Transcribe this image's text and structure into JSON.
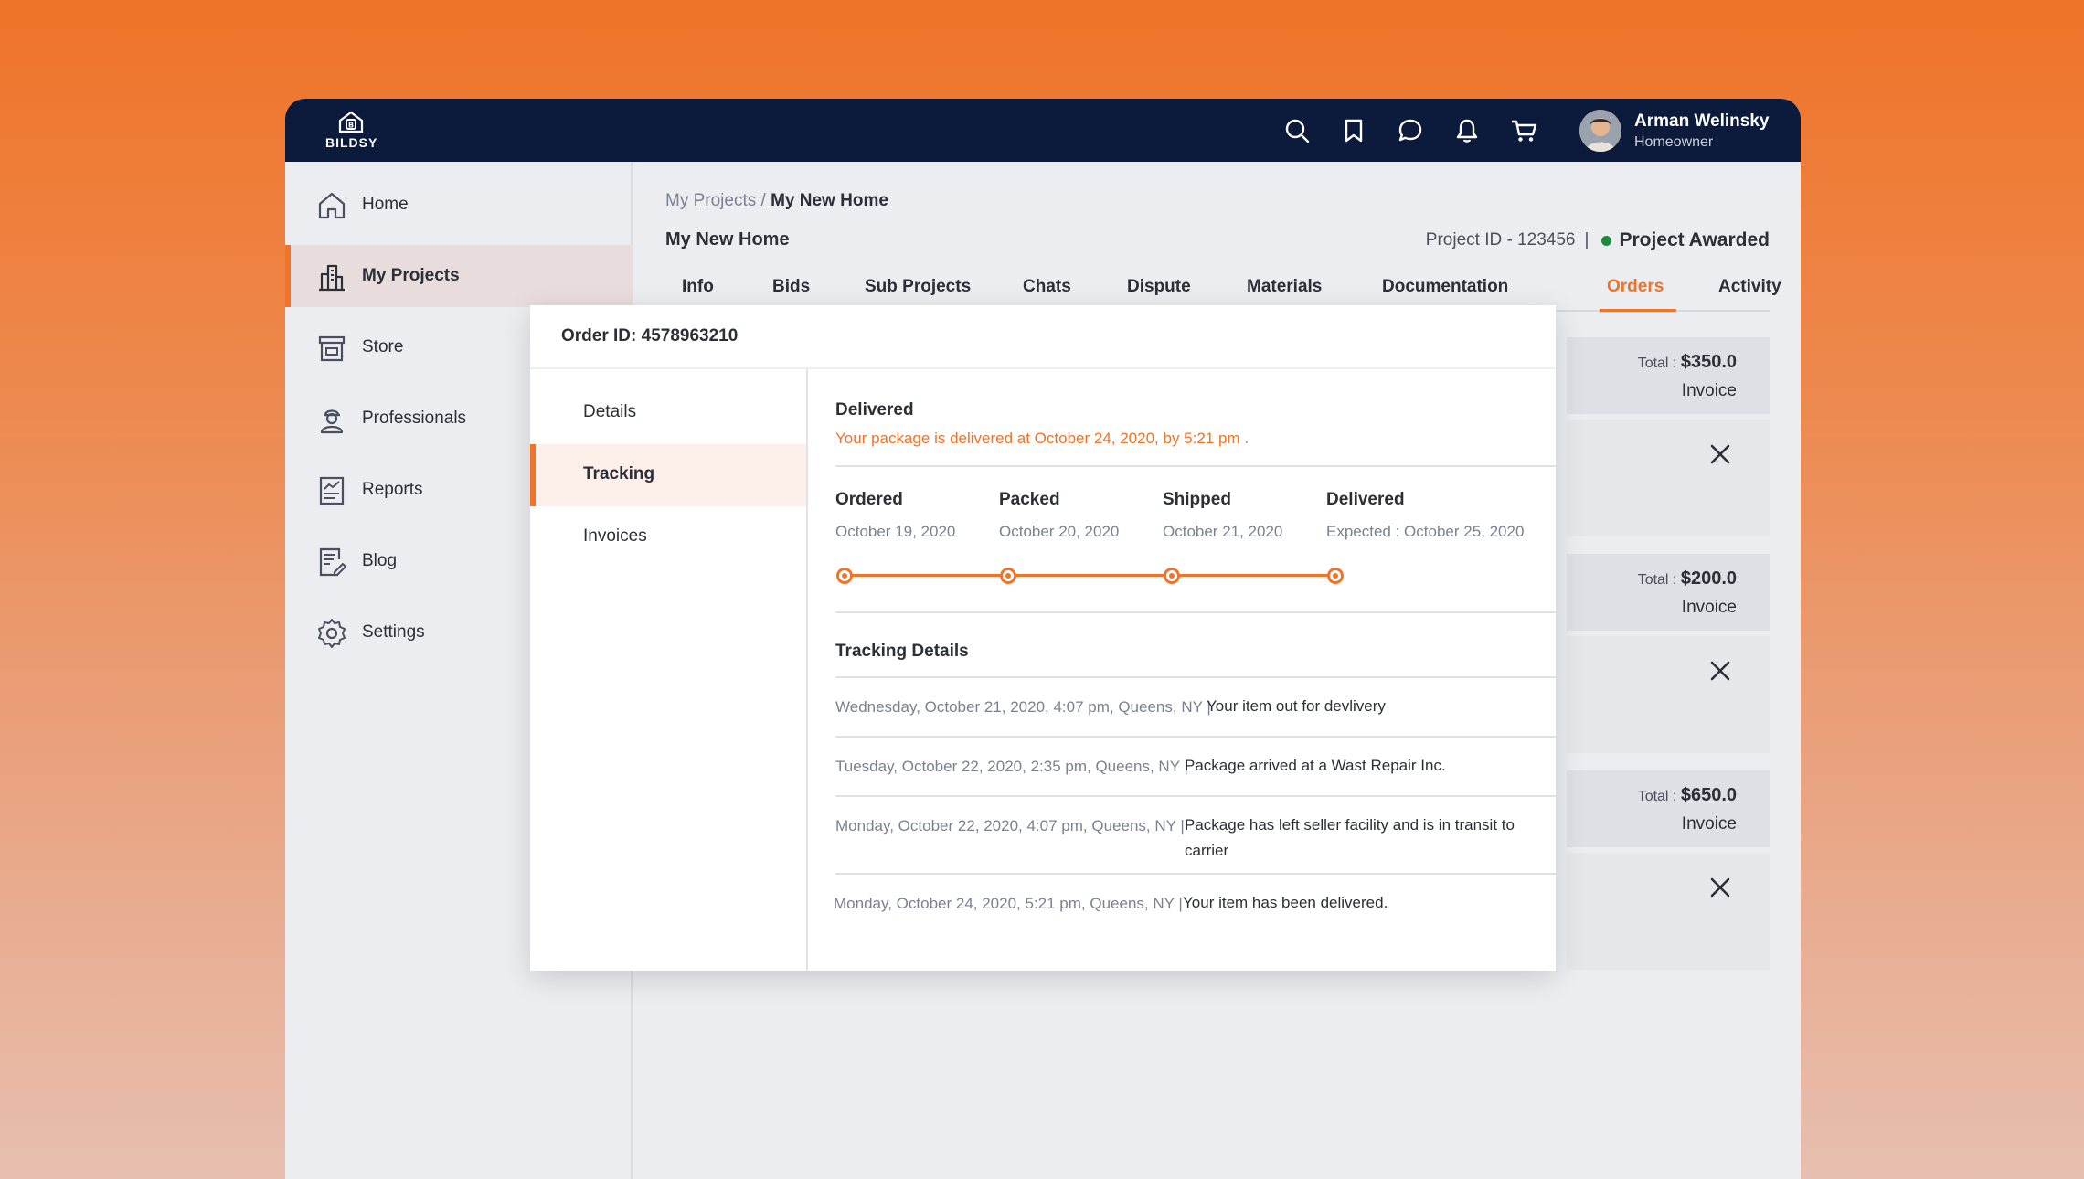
{
  "app": {
    "logo_text": "BILDSY"
  },
  "user": {
    "name": "Arman Welinsky",
    "role": "Homeowner"
  },
  "topbar_icons": [
    "search-icon",
    "bookmark-icon",
    "chat-icon",
    "bell-icon",
    "cart-icon"
  ],
  "sidebar": {
    "items": [
      {
        "label": "Home",
        "icon": "home-icon"
      },
      {
        "label": "My Projects",
        "icon": "projects-icon",
        "active": true
      },
      {
        "label": "Store",
        "icon": "store-icon"
      },
      {
        "label": "Professionals",
        "icon": "professional-icon"
      },
      {
        "label": "Reports",
        "icon": "reports-icon"
      },
      {
        "label": "Blog",
        "icon": "blog-icon"
      },
      {
        "label": "Settings",
        "icon": "settings-icon"
      }
    ]
  },
  "breadcrumb": {
    "parent": "My Projects",
    "separator": "/",
    "current": "My New Home"
  },
  "project": {
    "title": "My New Home",
    "id_text": "Project ID - 123456",
    "separator": "|",
    "status": "Project Awarded"
  },
  "tabs": [
    "Info",
    "Bids",
    "Sub Projects",
    "Chats",
    "Dispute",
    "Materials",
    "Documentation",
    "Orders",
    "Activity"
  ],
  "active_tab": "Orders",
  "orders": [
    {
      "total_label": "Total :",
      "total": "$350.0",
      "invoice": "Invoice"
    },
    {
      "total_label": "Total :",
      "total": "$200.0",
      "invoice": "Invoice"
    },
    {
      "total_label": "Total :",
      "total": "$650.0",
      "invoice": "Invoice"
    }
  ],
  "modal": {
    "order_id": "Order ID: 4578963210",
    "side_items": [
      "Details",
      "Tracking",
      "Invoices"
    ],
    "active_side": "Tracking",
    "status_title": "Delivered",
    "status_message": "Your package is delivered at October 24, 2020, by 5:21 pm .",
    "steps": [
      {
        "label": "Ordered",
        "date": "October 19, 2020"
      },
      {
        "label": "Packed",
        "date": "October 20, 2020"
      },
      {
        "label": "Shipped",
        "date": "October 21, 2020"
      },
      {
        "label": "Delivered",
        "date": "Expected : October 25, 2020"
      }
    ],
    "tracking_title": "Tracking Details",
    "events": [
      {
        "time": "Wednesday, October 21, 2020, 4:07 pm, Queens, NY |",
        "desc": "Your item out for devlivery"
      },
      {
        "time": "Tuesday, October 22, 2020, 2:35 pm, Queens, NY |",
        "desc": "Package arrived at a Wast Repair Inc."
      },
      {
        "time": "Monday, October 22, 2020, 4:07 pm, Queens, NY |",
        "desc": "Package has left seller facility and is in transit to carrier"
      },
      {
        "time": "Monday, October 24, 2020, 5:21 pm, Queens, NY |",
        "desc": "Your item has been delivered."
      }
    ]
  },
  "colors": {
    "accent": "#ef7328",
    "topbar": "#0c1b3c",
    "status_green": "#1f8a3e"
  }
}
